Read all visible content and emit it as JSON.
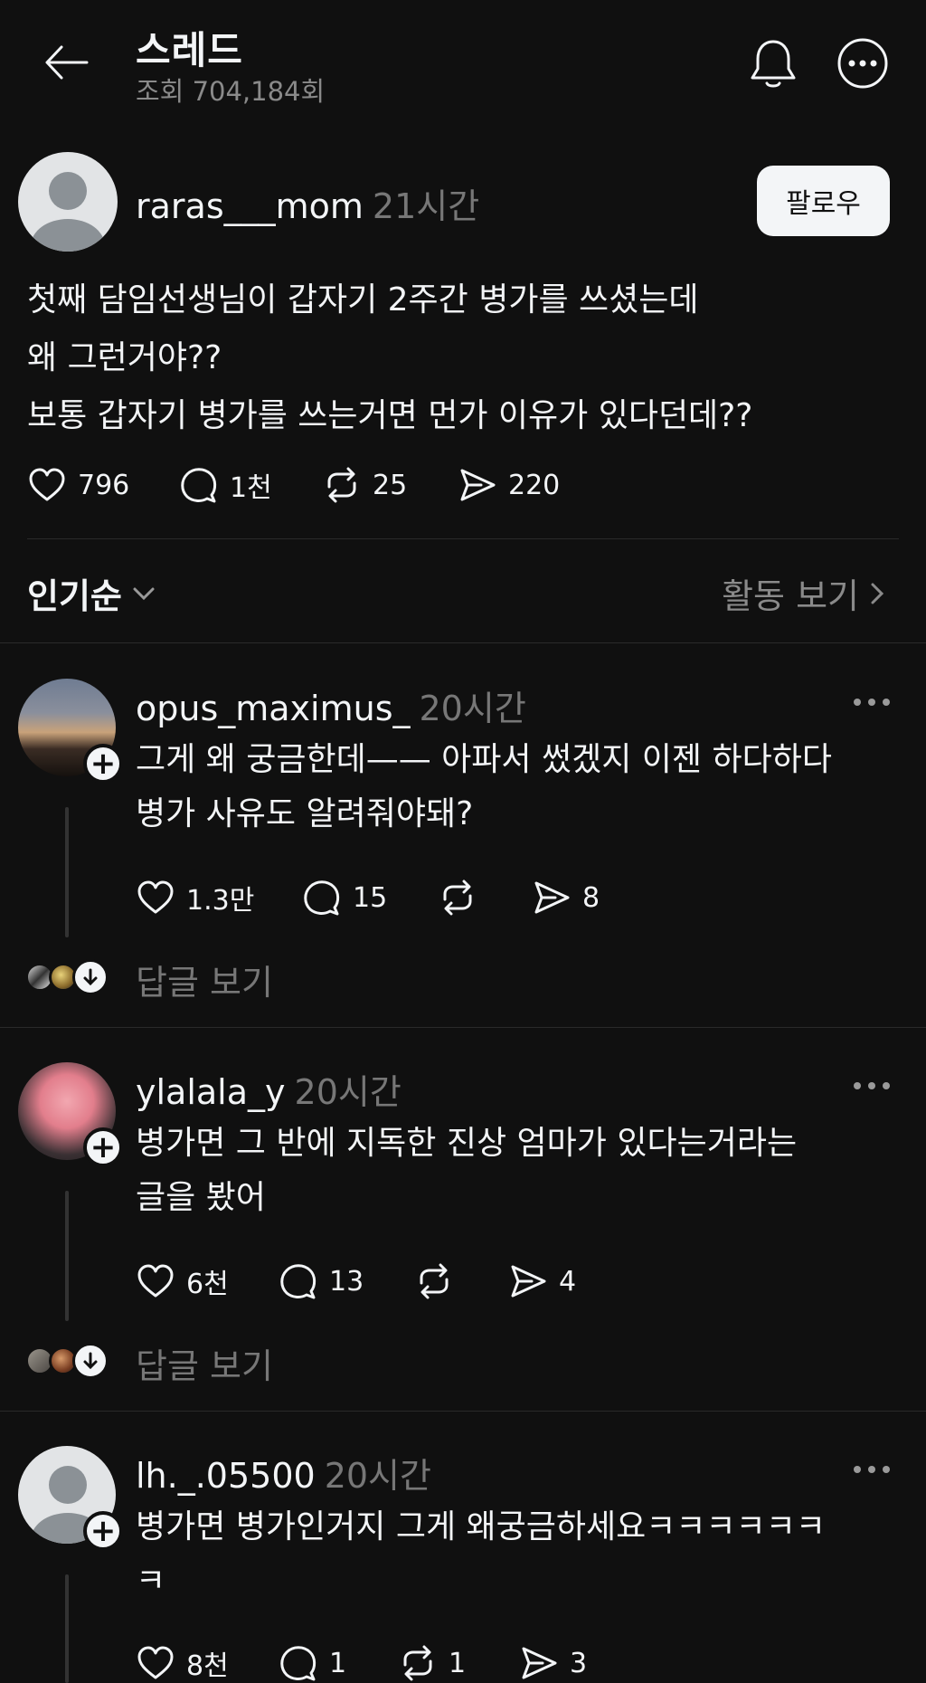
{
  "header": {
    "title": "스레드",
    "views": "조회 704,184회"
  },
  "post": {
    "username": "raras___mom",
    "time": "21시간",
    "follow_label": "팔로우",
    "text": "첫째 담임선생님이 갑자기 2주간 병가를 쓰셨는데\n왜 그런거야??\n보통 갑자기 병가를 쓰는거면 먼가 이유가 있다던데??",
    "likes": "796",
    "comments": "1천",
    "reposts": "25",
    "shares": "220"
  },
  "sort": {
    "label": "인기순",
    "activity_label": "활동 보기"
  },
  "comments": [
    {
      "username": "opus_maximus_",
      "time": "20시간",
      "text": "그게 왜 궁금한데—— 아파서 썼겠지 이젠 하다하다\n병가 사유도 알려줘야돼?",
      "likes": "1.3만",
      "comments": "15",
      "reposts": "",
      "shares": "8",
      "view_replies": "답글 보기"
    },
    {
      "username": "ylalala_y",
      "time": "20시간",
      "text": "병가면 그 반에 지독한 진상 엄마가 있다는거라는\n글을 봤어",
      "likes": "6천",
      "comments": "13",
      "reposts": "",
      "shares": "4",
      "view_replies": "답글 보기"
    },
    {
      "username": "lh._.05500",
      "time": "20시간",
      "text": "병가면 병가인거지 그게 왜궁금하세요ㅋㅋㅋㅋㅋㅋ\nㅋ",
      "likes": "8천",
      "comments": "1",
      "reposts": "1",
      "shares": "3"
    }
  ],
  "colors": {
    "background": "#101010",
    "text": "#f3f5f7",
    "muted": "#777777"
  }
}
